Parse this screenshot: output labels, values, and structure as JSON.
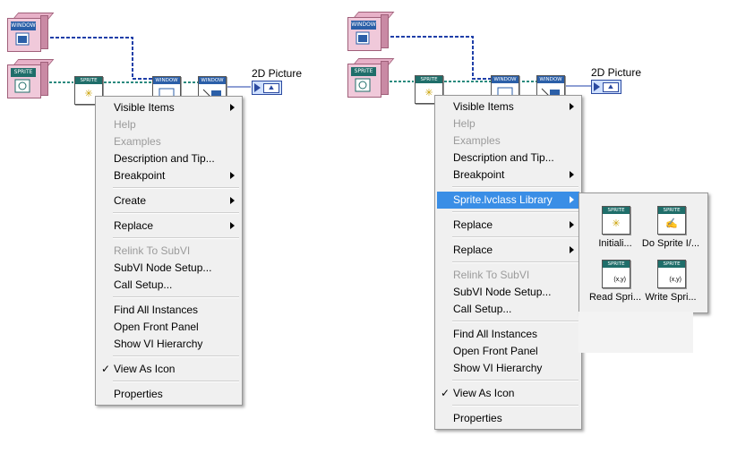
{
  "class_tags": {
    "window": "WINDOW",
    "sprite": "SPRITE"
  },
  "node_tags": {
    "sprite": "SPRITE",
    "window": "WINDOW"
  },
  "picture_label": "2D Picture",
  "colors": {
    "wire_blue": "#1f3fa8",
    "wire_teal": "#2a8a7e",
    "highlight": "#3a8ee6",
    "menu_bg": "#f0f0f0"
  },
  "left_menu": {
    "items": [
      {
        "label": "Visible Items",
        "submenu": true,
        "disabled": false
      },
      {
        "label": "Help",
        "submenu": false,
        "disabled": true
      },
      {
        "label": "Examples",
        "submenu": false,
        "disabled": true
      },
      {
        "label": "Description and Tip...",
        "submenu": false,
        "disabled": false
      },
      {
        "label": "Breakpoint",
        "submenu": true,
        "disabled": false
      },
      {
        "label": "Create",
        "submenu": true,
        "disabled": false
      },
      {
        "label": "Replace",
        "submenu": true,
        "disabled": false
      },
      {
        "label": "Relink To SubVI",
        "submenu": false,
        "disabled": true
      },
      {
        "label": "SubVI Node Setup...",
        "submenu": false,
        "disabled": false
      },
      {
        "label": "Call Setup...",
        "submenu": false,
        "disabled": false
      },
      {
        "label": "Find All Instances",
        "submenu": false,
        "disabled": false
      },
      {
        "label": "Open Front Panel",
        "submenu": false,
        "disabled": false
      },
      {
        "label": "Show VI Hierarchy",
        "submenu": false,
        "disabled": false
      },
      {
        "label": "View As Icon",
        "submenu": false,
        "disabled": false,
        "checked": true
      },
      {
        "label": "Properties",
        "submenu": false,
        "disabled": false
      }
    ]
  },
  "right_menu": {
    "items": [
      {
        "label": "Visible Items",
        "submenu": true,
        "disabled": false
      },
      {
        "label": "Help",
        "submenu": false,
        "disabled": true
      },
      {
        "label": "Examples",
        "submenu": false,
        "disabled": true
      },
      {
        "label": "Description and Tip...",
        "submenu": false,
        "disabled": false
      },
      {
        "label": "Breakpoint",
        "submenu": true,
        "disabled": false
      },
      {
        "label": "Sprite.lvclass Library",
        "submenu": true,
        "disabled": false,
        "highlighted": true
      },
      {
        "label": "Replace",
        "submenu": true,
        "disabled": false
      },
      {
        "label": "Replace",
        "submenu": true,
        "disabled": false
      },
      {
        "label": "Relink To SubVI",
        "submenu": false,
        "disabled": true
      },
      {
        "label": "SubVI Node Setup...",
        "submenu": false,
        "disabled": false
      },
      {
        "label": "Call Setup...",
        "submenu": false,
        "disabled": false
      },
      {
        "label": "Find All Instances",
        "submenu": false,
        "disabled": false
      },
      {
        "label": "Open Front Panel",
        "submenu": false,
        "disabled": false
      },
      {
        "label": "Show VI Hierarchy",
        "submenu": false,
        "disabled": false
      },
      {
        "label": "View As Icon",
        "submenu": false,
        "disabled": false,
        "checked": true
      },
      {
        "label": "Properties",
        "submenu": false,
        "disabled": false
      }
    ]
  },
  "palette": {
    "items": [
      {
        "label": "Initiali...",
        "tag": "SPRITE",
        "icon": "sparkle-icon"
      },
      {
        "label": "Do Sprite I/...",
        "tag": "SPRITE",
        "icon": "hand-icon"
      },
      {
        "label": "Read Spri...",
        "tag": "SPRITE",
        "icon": "xy-read-icon"
      },
      {
        "label": "Write Spri...",
        "tag": "SPRITE",
        "icon": "xy-write-icon"
      }
    ]
  },
  "checkmark": "✓",
  "glyphs": {
    "sparkle": "✳",
    "hand": "✍",
    "xy": "(x,y)"
  }
}
